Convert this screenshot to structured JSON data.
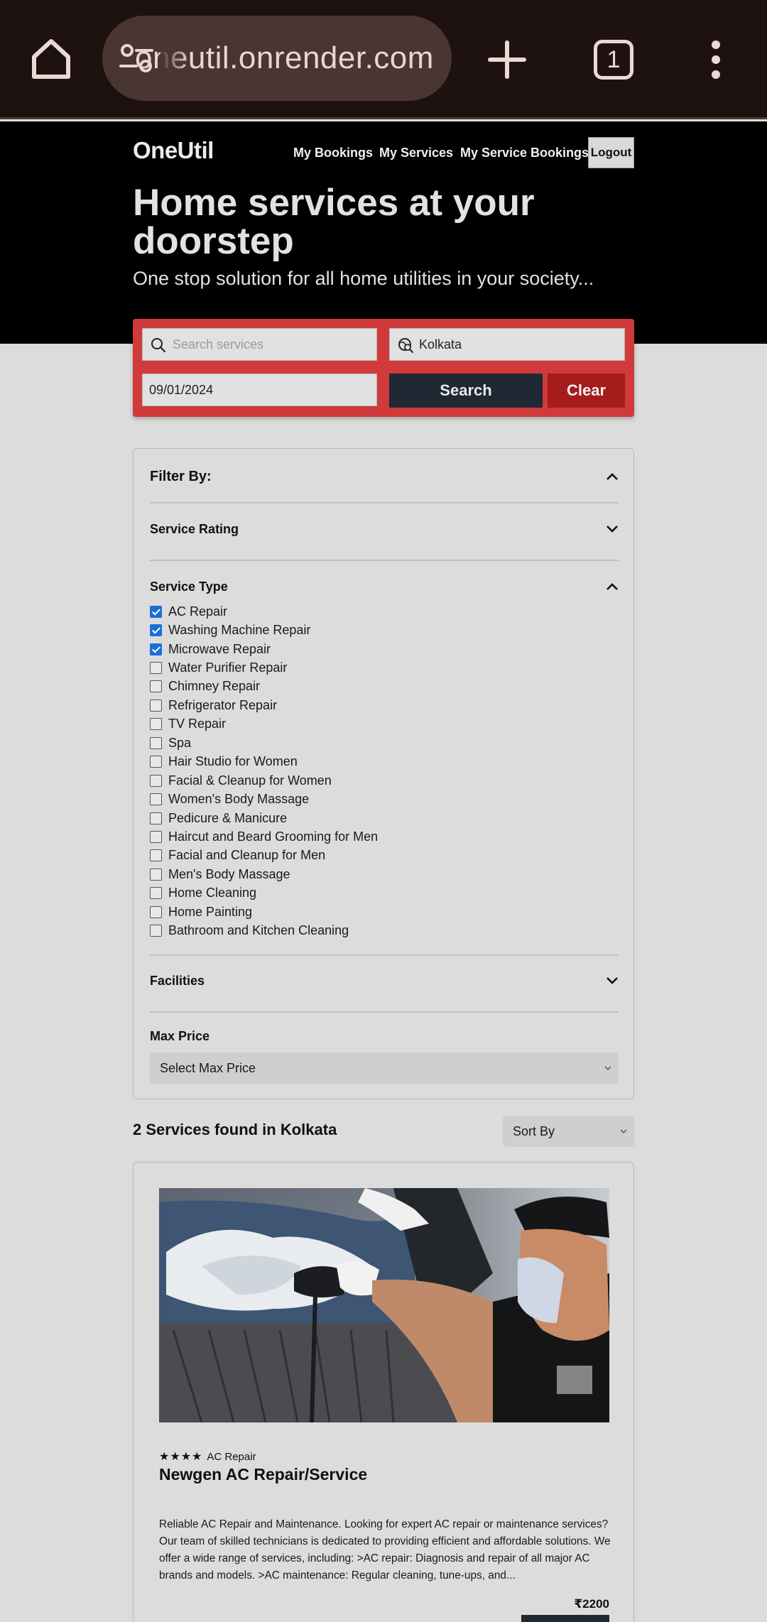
{
  "browser": {
    "url": "oneutil.onrender.com",
    "tab_count": "1",
    "icons": [
      "home-icon",
      "site-settings-icon",
      "new-tab-icon",
      "tab-switcher-icon",
      "more-menu-icon"
    ]
  },
  "header": {
    "brand": "OneUtil",
    "nav": {
      "my_bookings": "My Bookings",
      "my_services": "My Services",
      "my_service_bookings": "My Service Bookings",
      "logout": "Logout"
    },
    "title": "Home services at your doorstep",
    "subtitle": "One stop solution for all home utilities in your society..."
  },
  "search": {
    "placeholder": "Search services",
    "location": "Kolkata",
    "date": "09/01/2024",
    "search_label": "Search",
    "clear_label": "Clear",
    "accent_color": "#d03a3a"
  },
  "filters": {
    "title": "Filter By:",
    "service_rating": "Service Rating",
    "service_type": "Service Type",
    "service_types": [
      {
        "label": "AC Repair",
        "checked": true
      },
      {
        "label": "Washing Machine Repair",
        "checked": true
      },
      {
        "label": "Microwave Repair",
        "checked": true
      },
      {
        "label": "Water Purifier Repair",
        "checked": false
      },
      {
        "label": "Chimney Repair",
        "checked": false
      },
      {
        "label": "Refrigerator Repair",
        "checked": false
      },
      {
        "label": "TV Repair",
        "checked": false
      },
      {
        "label": "Spa",
        "checked": false
      },
      {
        "label": "Hair Studio for Women",
        "checked": false
      },
      {
        "label": "Facial & Cleanup for Women",
        "checked": false
      },
      {
        "label": "Women's Body Massage",
        "checked": false
      },
      {
        "label": "Pedicure & Manicure",
        "checked": false
      },
      {
        "label": "Haircut and Beard Grooming for Men",
        "checked": false
      },
      {
        "label": "Facial and Cleanup for Men",
        "checked": false
      },
      {
        "label": "Men's Body Massage",
        "checked": false
      },
      {
        "label": "Home Cleaning",
        "checked": false
      },
      {
        "label": "Home Painting",
        "checked": false
      },
      {
        "label": "Bathroom and Kitchen Cleaning",
        "checked": false
      }
    ],
    "facilities": "Facilities",
    "max_price": "Max Price",
    "max_price_select": "Select Max Price"
  },
  "results": {
    "count_text": "2 Services found in Kolkata",
    "sort_label": "Sort By"
  },
  "service_card": {
    "rating": 4,
    "category": "AC Repair",
    "title": "Newgen AC Repair/Service",
    "description": "Reliable AC Repair and Maintenance. Looking for expert AC repair or maintenance services? Our team of skilled technicians is dedicated to providing efficient and affordable solutions. We offer a wide range of services, including: >AC repair: Diagnosis and repair of all major AC brands and models. >AC maintenance: Regular cleaning, tune-ups, and...",
    "price": "₹2200"
  }
}
